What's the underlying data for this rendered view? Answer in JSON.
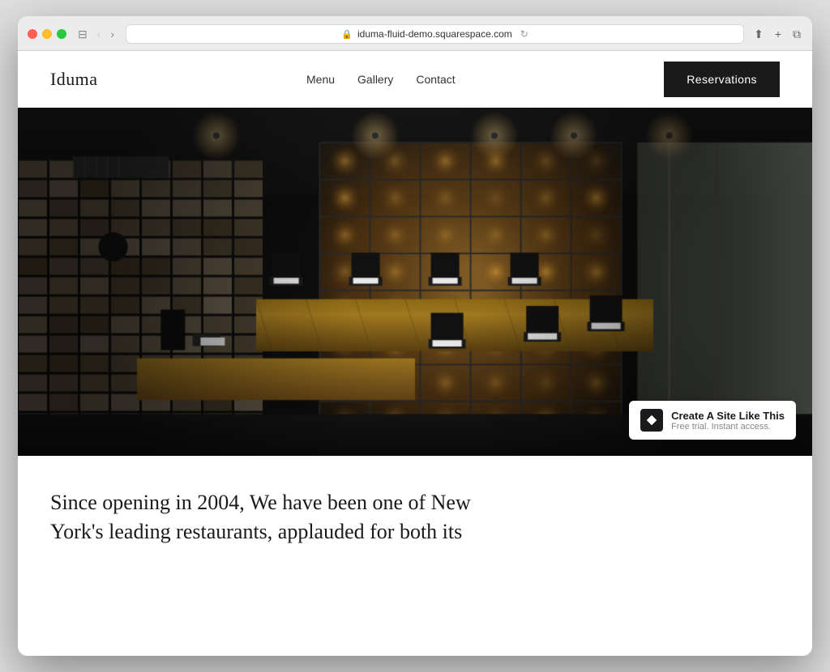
{
  "browser": {
    "url": "iduma-fluid-demo.squarespace.com",
    "refresh_icon": "↻",
    "back_icon": "‹",
    "forward_icon": "›",
    "share_icon": "⬆",
    "plus_icon": "+",
    "tabs_icon": "⧉",
    "sidebar_icon": "⊟",
    "lock_icon": "🔒"
  },
  "site": {
    "logo": "Iduma",
    "nav": {
      "items": [
        {
          "label": "Menu",
          "href": "#"
        },
        {
          "label": "Gallery",
          "href": "#"
        },
        {
          "label": "Contact",
          "href": "#"
        }
      ]
    },
    "reservations_label": "Reservations",
    "hero_alt": "Restaurant interior with wine display shelving and dining tables",
    "body_text_line1": "Since opening in 2004, We have been one of New",
    "body_text_line2": "York's leading restaurants, applauded for both its"
  },
  "squarespace_badge": {
    "logo_char": "✦",
    "title": "Create A Site Like This",
    "subtitle": "Free trial. Instant access."
  },
  "colors": {
    "reservations_bg": "#1a1a1a",
    "reservations_text": "#ffffff",
    "logo_color": "#1a1a1a",
    "nav_color": "#333333",
    "body_text": "#1a1a1a"
  }
}
